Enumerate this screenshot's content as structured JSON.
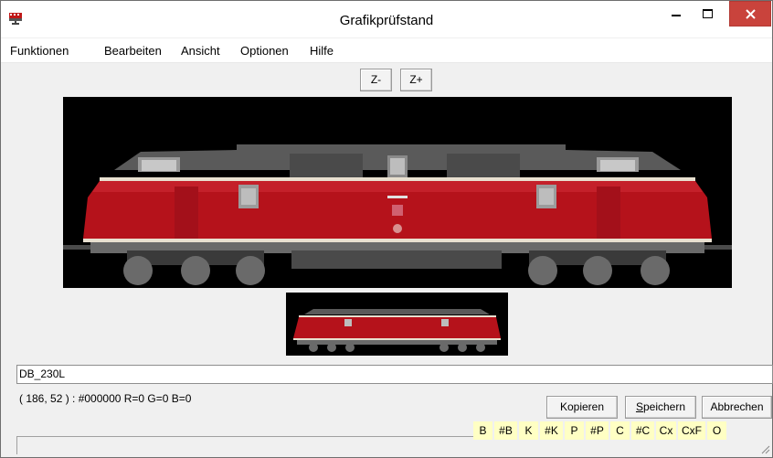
{
  "window": {
    "title": "Grafikprüfstand",
    "controls": {
      "minimize": "minimize",
      "maximize": "maximize",
      "close": "close"
    }
  },
  "menu": {
    "items": [
      "Funktionen",
      "Bearbeiten",
      "Ansicht",
      "Optionen",
      "Hilfe"
    ]
  },
  "zoom": {
    "out_label": "Z-",
    "in_label": "Z+"
  },
  "name_field": {
    "value": "DB_230L"
  },
  "status": {
    "pixel_info": "( 186, 52 ) : #000000 R=0 G=0 B=0"
  },
  "buttons": {
    "copy": "Kopieren",
    "save_underlined": "S",
    "save_rest": "peichern",
    "cancel": "Abbrechen"
  },
  "flags": [
    "B",
    "#B",
    "K",
    "#K",
    "P",
    "#P",
    "C",
    "#C",
    "Cx",
    "CxF",
    "O"
  ],
  "colors": {
    "loco_red": "#b5121b",
    "loco_roof": "#5c5c5c",
    "canvas_bg": "#000000",
    "flag_bg": "#ffffc4",
    "close_btn": "#c9433c"
  }
}
